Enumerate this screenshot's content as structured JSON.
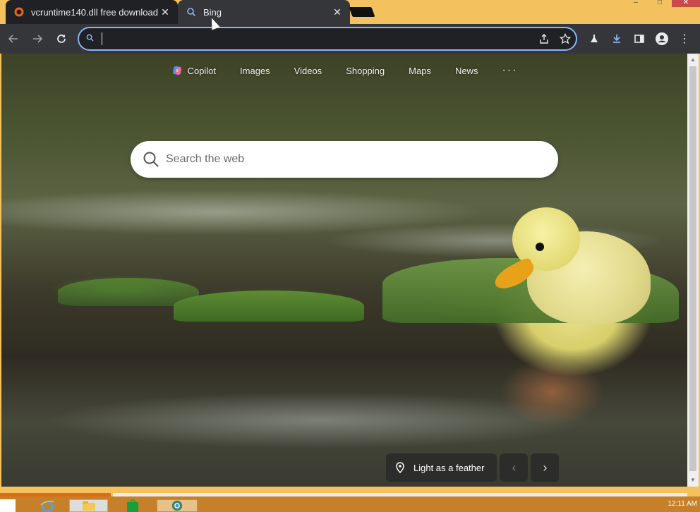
{
  "tabs": [
    {
      "title": "vcruntime140.dll free download",
      "icon": "gear-icon",
      "active": false
    },
    {
      "title": "Bing",
      "icon": "search-icon",
      "active": true
    }
  ],
  "toolbar": {
    "back": "back-arrow-icon",
    "forward": "forward-arrow-icon",
    "reload": "reload-icon",
    "omnibox_value": "",
    "omnibox_placeholder": ""
  },
  "bing": {
    "nav": [
      "Copilot",
      "Images",
      "Videos",
      "Shopping",
      "Maps",
      "News"
    ],
    "more": "···",
    "search_placeholder": "Search the web",
    "caption": "Light as a feather"
  },
  "taskbar": {
    "clock": "12:11 AM"
  },
  "colors": {
    "tab_active_bg": "#35363a",
    "omnibox_focus": "#8ab4f8",
    "window_frame": "#f3c15d"
  }
}
